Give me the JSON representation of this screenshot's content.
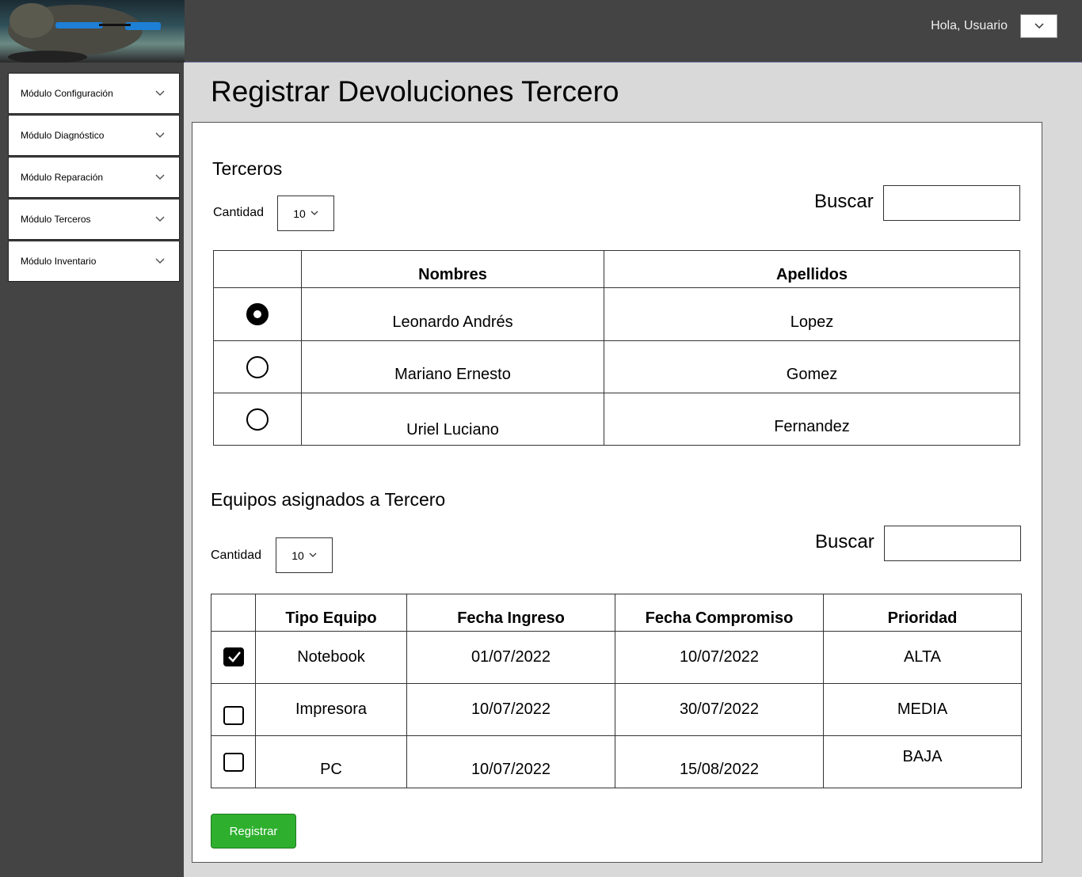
{
  "header": {
    "greeting": "Hola, Usuario",
    "user_menu_icon": "chevron-down-icon"
  },
  "sidebar": {
    "items": [
      {
        "label": "Módulo Configuración"
      },
      {
        "label": "Módulo Diagnóstico"
      },
      {
        "label": "Módulo Reparación"
      },
      {
        "label": "Módulo Terceros"
      },
      {
        "label": "Módulo Inventario"
      }
    ]
  },
  "page": {
    "title": "Registrar Devoluciones Tercero"
  },
  "terceros": {
    "title": "Terceros",
    "cantidad_label": "Cantidad",
    "cantidad_value": "10",
    "search_label": "Buscar",
    "search_value": "",
    "columns": [
      "",
      "Nombres",
      "Apellidos"
    ],
    "rows": [
      {
        "selected": true,
        "nombres": "Leonardo Andrés",
        "apellidos": "Lopez"
      },
      {
        "selected": false,
        "nombres": "Mariano Ernesto",
        "apellidos": "Gomez"
      },
      {
        "selected": false,
        "nombres": "Uriel Luciano",
        "apellidos": "Fernandez"
      }
    ]
  },
  "equipos": {
    "title": "Equipos asignados a Tercero",
    "cantidad_label": "Cantidad",
    "cantidad_value": "10",
    "search_label": "Buscar",
    "search_value": "",
    "columns": [
      "",
      "Tipo Equipo",
      "Fecha Ingreso",
      "Fecha Compromiso",
      "Prioridad"
    ],
    "rows": [
      {
        "checked": true,
        "tipo": "Notebook",
        "ingreso": "01/07/2022",
        "compromiso": "10/07/2022",
        "prioridad": "ALTA"
      },
      {
        "checked": false,
        "tipo": "Impresora",
        "ingreso": "10/07/2022",
        "compromiso": "30/07/2022",
        "prioridad": "MEDIA"
      },
      {
        "checked": false,
        "tipo": "PC",
        "ingreso": "10/07/2022",
        "compromiso": "15/08/2022",
        "prioridad": "BAJA"
      }
    ]
  },
  "actions": {
    "register_label": "Registrar",
    "register_color": "#2eb02e"
  }
}
